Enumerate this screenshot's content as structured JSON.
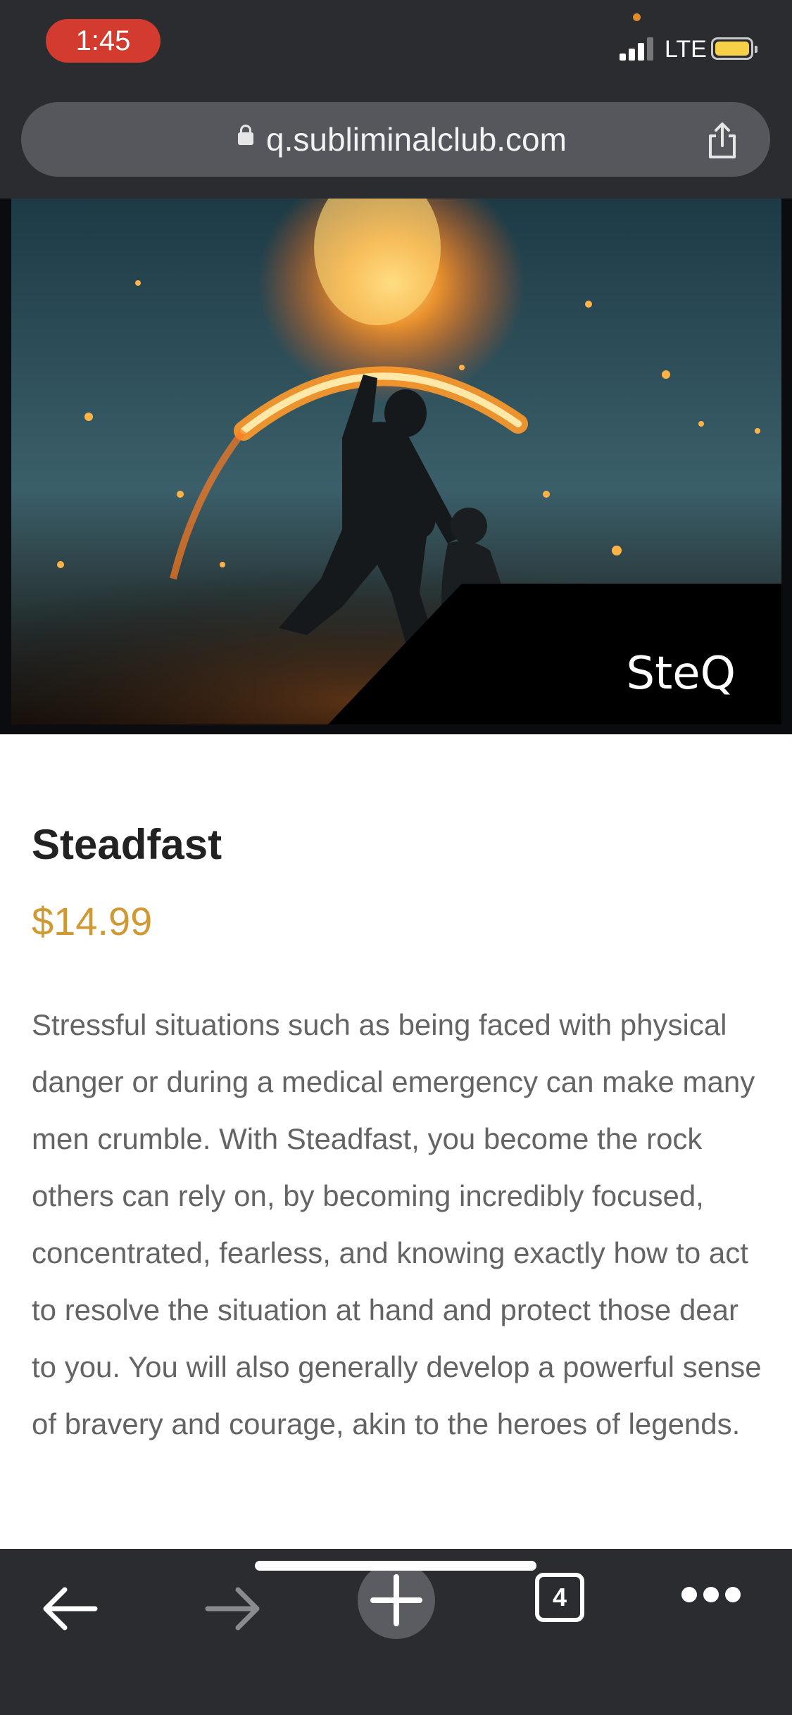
{
  "status_bar": {
    "time": "1:45",
    "network": "LTE",
    "time_pill_color": "#d33b2f",
    "battery_color": "#f6d048"
  },
  "browser": {
    "url": "q.subliminalclub.com",
    "icons": [
      "lock-icon",
      "share-icon"
    ]
  },
  "hero": {
    "badge": "SteQ"
  },
  "product": {
    "title": "Steadfast",
    "price": "$14.99",
    "price_color": "#cf9a33",
    "description": "Stressful situations such as being faced with physical danger or during a medical emergency can make many men crumble. With Steadfast, you become the rock others can rely on, by becoming incredibly focused, concentrated, fearless, and knowing exactly how to act to resolve the situation at hand and protect those dear to you. You will also generally develop a powerful sense of bravery and courage, akin to the heroes of legends."
  },
  "toolbar": {
    "tab_count": "4",
    "icons": [
      "back-arrow-icon",
      "forward-arrow-icon",
      "plus-icon",
      "tabs-icon",
      "more-icon"
    ]
  }
}
